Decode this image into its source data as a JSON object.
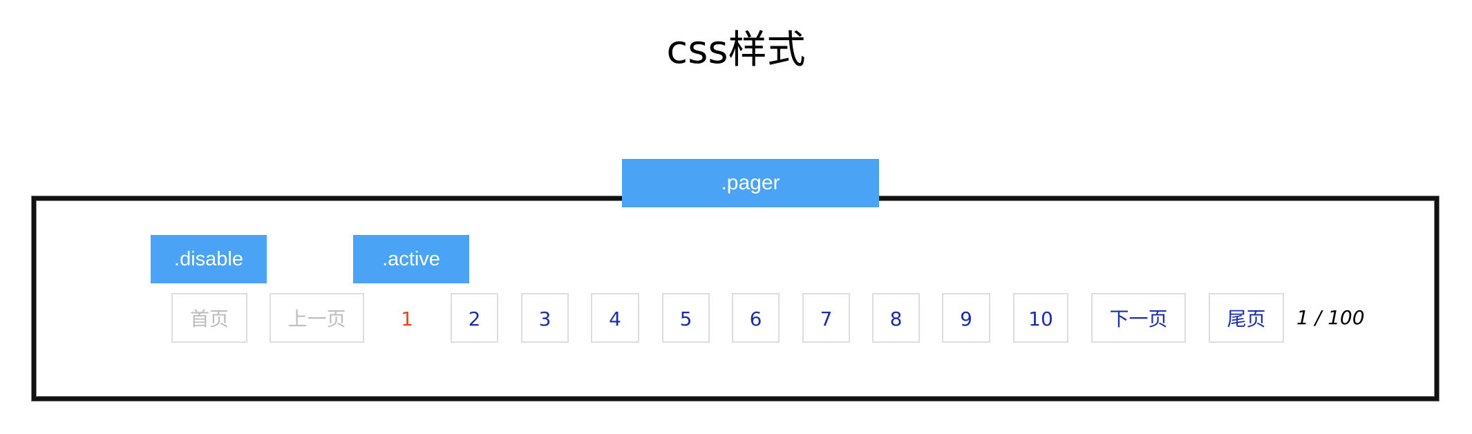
{
  "title": "css样式",
  "tags": {
    "pager": ".pager",
    "disable": ".disable",
    "active": ".active"
  },
  "pager": {
    "first": "首页",
    "prev": "上一页",
    "pages": [
      "1",
      "2",
      "3",
      "4",
      "5",
      "6",
      "7",
      "8",
      "9",
      "10"
    ],
    "next": "下一页",
    "last": "尾页",
    "current_page": "1",
    "total_pages": "100",
    "separator": "/"
  },
  "colors": {
    "tag_background": "#4ba3f5",
    "link_text": "#1a2bb0",
    "active_text": "#e8431f",
    "disabled_text": "#bdbdbd",
    "button_border": "#dddddd",
    "frame_border": "#111111"
  }
}
